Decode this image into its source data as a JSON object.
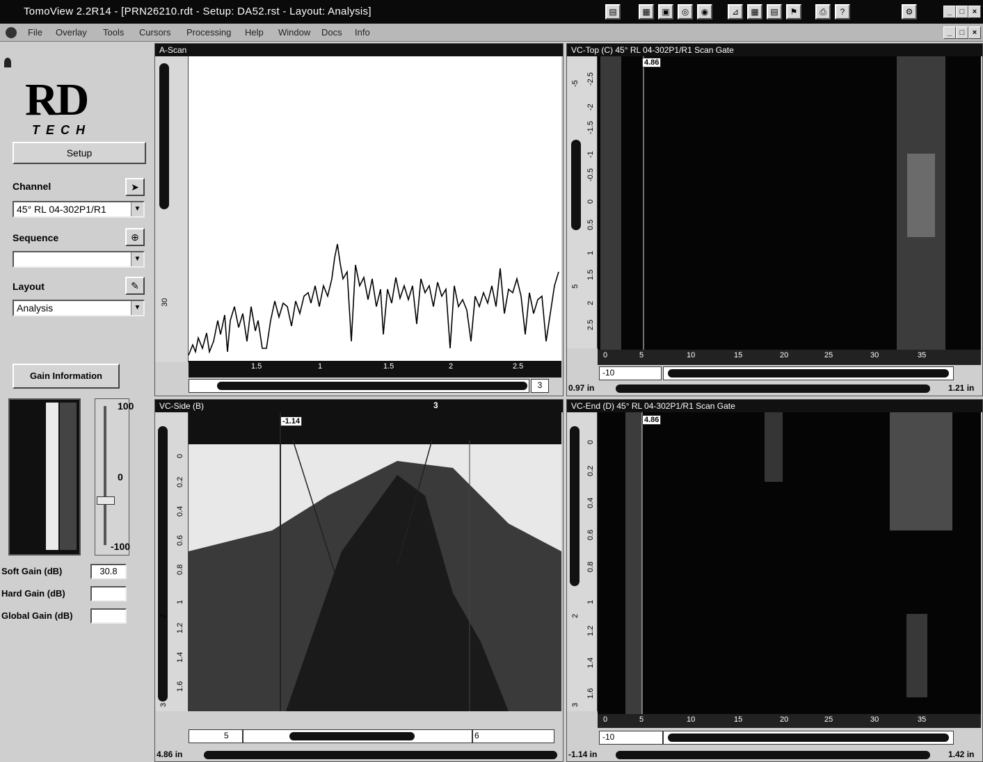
{
  "titlebar": {
    "title": "TomoView 2.2R14 - [PRN26210.rdt - Setup: DA52.rst - Layout: Analysis]"
  },
  "menubar": {
    "items": [
      "File",
      "Overlay",
      "Tools",
      "Cursors",
      "Processing",
      "Help",
      "Window",
      "Docs",
      "Info"
    ]
  },
  "left_panel": {
    "logo_main": "RD",
    "logo_sub": "TECH",
    "setup_label": "Setup",
    "channel_label": "Channel",
    "channel_value": "45° RL 04-302P1/R1",
    "sequence_label": "Sequence",
    "sequence_value": "",
    "layout_label": "Layout",
    "layout_value": "Analysis",
    "gain_info_label": "Gain Information",
    "slider_max": "100",
    "slider_mid": "0",
    "slider_min": "-100",
    "soft_gain_label": "Soft Gain (dB)",
    "soft_gain_value": "30.8",
    "hard_gain_label": "Hard Gain (dB)",
    "hard_gain_value": "",
    "global_gain_label": "Global Gain (dB)",
    "global_gain_value": ""
  },
  "panes": {
    "ascan": {
      "title": "A-Scan",
      "v_labels": [
        "30"
      ],
      "h_labels": [
        "1.5",
        "1",
        "1.5",
        "2",
        "2.5"
      ],
      "range_value": "3"
    },
    "ctop": {
      "title": "VC-Top (C) 45° RL 04-302P1/R1 Scan Gate",
      "cursor_value": "4.86",
      "v_labels": [
        "-2.5",
        "-2",
        "-1.5",
        "-1",
        "-0.5",
        "0",
        "0.5",
        "1",
        "1.5",
        "2",
        "2.5"
      ],
      "ruler_labels": [
        "-5",
        "5"
      ],
      "h_labels": [
        "0",
        "5",
        "10",
        "15",
        "20",
        "25",
        "30",
        "35"
      ],
      "start_value": "-10",
      "left_readout": "0.97 in",
      "right_readout": "1.21 in"
    },
    "bscan": {
      "title": "VC-Side (B)",
      "cursor_value": "-1.14",
      "top_label": "3",
      "v_labels": [
        "0",
        "0.2",
        "0.4",
        "0.6",
        "0.8",
        "1",
        "1.2",
        "1.4",
        "1.6"
      ],
      "ruler_labels": [
        "2",
        "3"
      ],
      "start_value": "5",
      "end_value": "6",
      "left_readout": "4.86 in"
    },
    "cend": {
      "title": "VC-End (D) 45° RL 04-302P1/R1 Scan Gate",
      "cursor_value": "4.86",
      "v_labels": [
        "0",
        "0.2",
        "0.4",
        "0.6",
        "0.8",
        "1",
        "1.2",
        "1.4",
        "1.6"
      ],
      "ruler_labels": [
        "2",
        "3"
      ],
      "h_labels": [
        "0",
        "5",
        "10",
        "15",
        "20",
        "25",
        "30",
        "35"
      ],
      "start_value": "-10",
      "left_readout": "-1.14 in",
      "right_readout": "1.42 in"
    }
  },
  "colors": {
    "titlebar": "#0a0a0a",
    "panel": "#cfcfcf",
    "scan_bg": "#050505",
    "ascan_bg": "#ffffff"
  }
}
